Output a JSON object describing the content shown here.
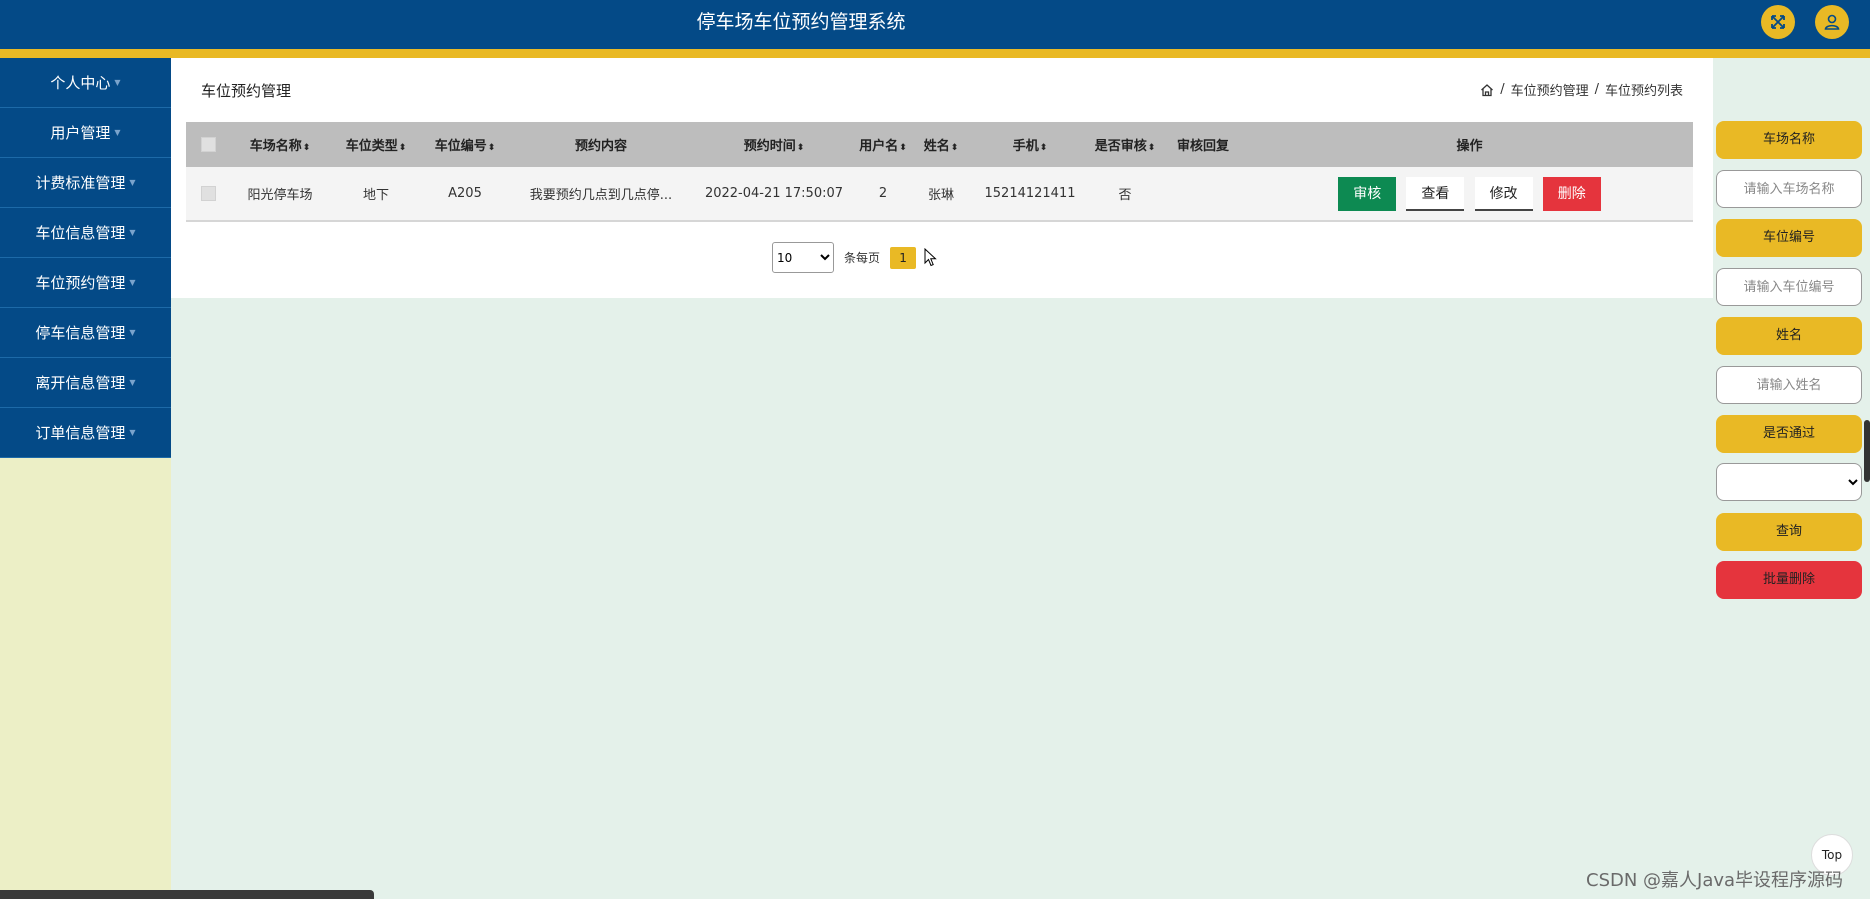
{
  "header": {
    "title": "停车场车位预约管理系统",
    "fullscreen_icon": "expand-icon",
    "user_icon": "user-icon"
  },
  "sidebar": {
    "items": [
      {
        "label": "个人中心"
      },
      {
        "label": "用户管理"
      },
      {
        "label": "计费标准管理"
      },
      {
        "label": "车位信息管理"
      },
      {
        "label": "车位预约管理"
      },
      {
        "label": "停车信息管理"
      },
      {
        "label": "离开信息管理"
      },
      {
        "label": "订单信息管理"
      }
    ]
  },
  "main": {
    "page_title": "车位预约管理",
    "breadcrumb": [
      "车位预约管理",
      "车位预约列表"
    ],
    "table": {
      "columns": [
        "车场名称",
        "车位类型",
        "车位编号",
        "预约内容",
        "预约时间",
        "用户名",
        "姓名",
        "手机",
        "是否审核",
        "审核回复",
        "操作"
      ],
      "rows": [
        {
          "lot_name": "阳光停车场",
          "space_type": "地下",
          "space_no": "A205",
          "content": "我要预约几点到几点停...",
          "time": "2022-04-21 17:50:07",
          "username": "2",
          "name": "张琳",
          "phone": "15214121411",
          "audited": "否",
          "reply": ""
        }
      ],
      "actions": {
        "audit": "审核",
        "view": "查看",
        "edit": "修改",
        "delete": "删除"
      }
    },
    "pagination": {
      "page_size": "10",
      "per_page_label": "条每页",
      "current_page": "1"
    }
  },
  "search": {
    "lot_name_label": "车场名称",
    "lot_name_placeholder": "请输入车场名称",
    "space_no_label": "车位编号",
    "space_no_placeholder": "请输入车位编号",
    "name_label": "姓名",
    "name_placeholder": "请输入姓名",
    "passed_label": "是否通过",
    "passed_value": "",
    "query_button": "查询",
    "batch_delete_button": "批量删除"
  },
  "misc": {
    "top_button": "Top",
    "watermark": "CSDN @嘉人Java毕设程序源码"
  },
  "colors": {
    "header_bg": "#044a87",
    "accent": "#e9b925",
    "danger": "#e5343d",
    "audit_green": "#0d8a52"
  }
}
